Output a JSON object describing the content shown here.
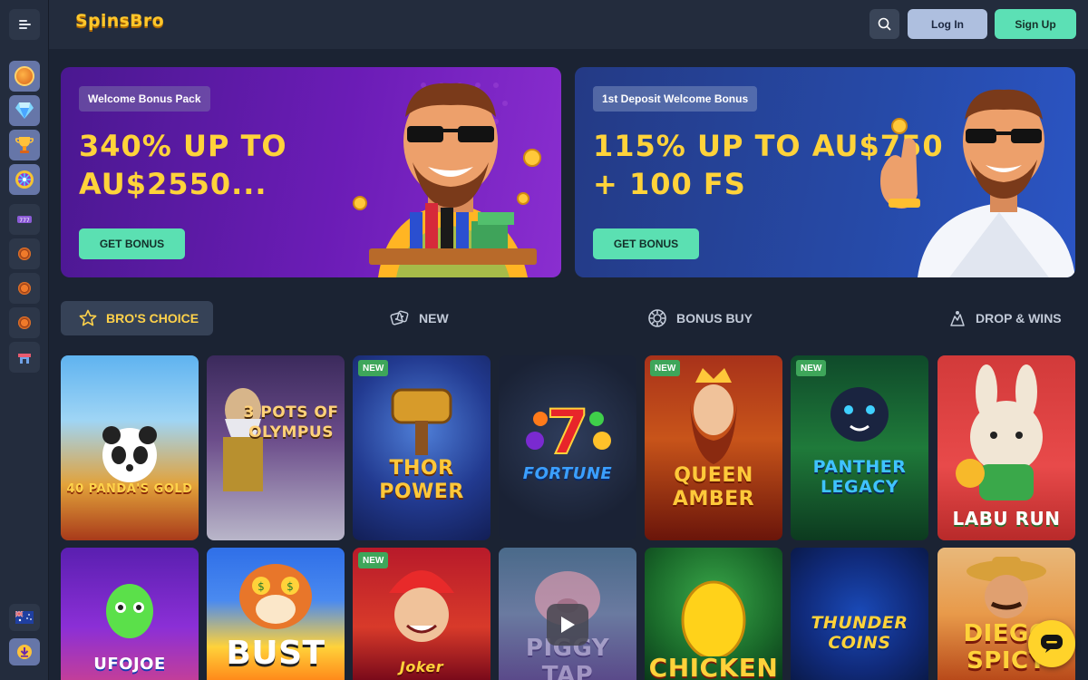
{
  "header": {
    "logo": "SpinsBro",
    "login_label": "Log In",
    "signup_label": "Sign Up"
  },
  "banners": [
    {
      "badge": "Welcome Bonus Pack",
      "headline": "340% UP TO\nAU$2550...",
      "button": "GET BONUS"
    },
    {
      "badge": "1st Deposit Welcome Bonus",
      "headline": "115% UP TO AU$750\n+ 100 FS",
      "button": "GET BONUS"
    }
  ],
  "tabs": [
    {
      "label": "BRO'S CHOICE",
      "icon": "star-icon"
    },
    {
      "label": "NEW",
      "icon": "dice-icon"
    },
    {
      "label": "BONUS BUY",
      "icon": "gear-icon"
    },
    {
      "label": "DROP & WINS",
      "icon": "drops-icon"
    }
  ],
  "games": [
    {
      "title": "40 PANDA'S GOLD",
      "new": ""
    },
    {
      "title": "3 POTS OF OLYMPUS",
      "new": ""
    },
    {
      "title": "THOR POWER",
      "new": "NEW"
    },
    {
      "title": "FORTUNE",
      "new": ""
    },
    {
      "title": "QUEEN AMBER",
      "new": "NEW"
    },
    {
      "title": "PANTHER LEGACY",
      "new": "NEW"
    },
    {
      "title": "LABU RUN",
      "new": ""
    },
    {
      "title": "UFOJOE",
      "new": ""
    },
    {
      "title": "BUST",
      "new": ""
    },
    {
      "title": "Joker",
      "new": "NEW"
    },
    {
      "title": "PIGGY TAP",
      "new": ""
    },
    {
      "title": "CHICKEN",
      "new": ""
    },
    {
      "title": "THUNDER COINS",
      "new": ""
    },
    {
      "title": "DIEGO SPICY",
      "new": ""
    }
  ],
  "colors": {
    "accent_gold": "#ffd33a",
    "accent_green": "#5be0b2",
    "login_blue": "#aebfdf"
  }
}
